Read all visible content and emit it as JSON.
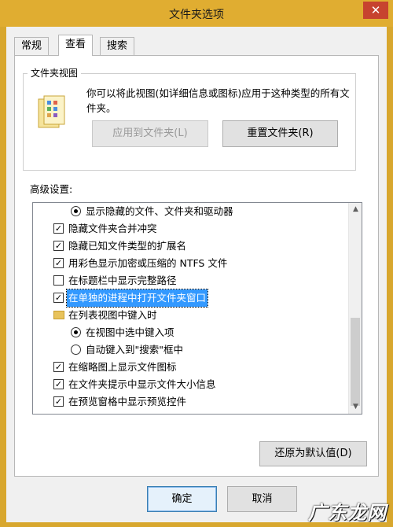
{
  "window": {
    "title": "文件夹选项",
    "close_symbol": "✕"
  },
  "tabs": [
    {
      "label": "常规",
      "active": false
    },
    {
      "label": "查看",
      "active": true
    },
    {
      "label": "搜索",
      "active": false
    }
  ],
  "folder_views": {
    "group_title": "文件夹视图",
    "description": "你可以将此视图(如详细信息或图标)应用于这种类型的所有文件夹。",
    "apply_label": "应用到文件夹(L)",
    "reset_label": "重置文件夹(R)"
  },
  "advanced": {
    "label": "高级设置:",
    "items": [
      {
        "type": "radio",
        "checked": true,
        "label": "显示隐藏的文件、文件夹和驱动器"
      },
      {
        "type": "checkbox",
        "checked": true,
        "label": "隐藏文件夹合并冲突"
      },
      {
        "type": "checkbox",
        "checked": true,
        "label": "隐藏已知文件类型的扩展名"
      },
      {
        "type": "checkbox",
        "checked": true,
        "label": "用彩色显示加密或压缩的 NTFS 文件"
      },
      {
        "type": "checkbox",
        "checked": false,
        "label": "在标题栏中显示完整路径"
      },
      {
        "type": "checkbox",
        "checked": true,
        "label": "在单独的进程中打开文件夹窗口",
        "selected": true
      },
      {
        "type": "folder",
        "label": "在列表视图中键入时"
      },
      {
        "type": "radio",
        "checked": true,
        "label": "在视图中选中键入项"
      },
      {
        "type": "radio",
        "checked": false,
        "label": "自动键入到\"搜索\"框中"
      },
      {
        "type": "checkbox",
        "checked": true,
        "label": "在缩略图上显示文件图标"
      },
      {
        "type": "checkbox",
        "checked": true,
        "label": "在文件夹提示中显示文件大小信息"
      },
      {
        "type": "checkbox",
        "checked": true,
        "label": "在预览窗格中显示预览控件"
      }
    ],
    "restore_label": "还原为默认值(D)"
  },
  "footer": {
    "ok_label": "确定",
    "cancel_label": "取消"
  },
  "watermark": {
    "text": "广东龙网"
  },
  "colors": {
    "title_bar": "#e0ad31",
    "selection": "#3399ff",
    "close": "#c7432f"
  }
}
